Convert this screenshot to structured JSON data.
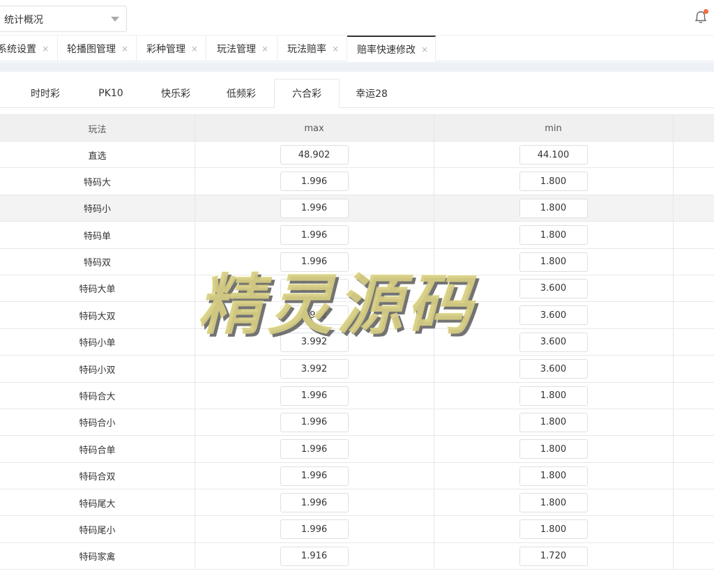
{
  "header": {
    "select_value": "统计概况"
  },
  "tabs": [
    {
      "label": "系统设置",
      "close": "×"
    },
    {
      "label": "轮播图管理",
      "close": "×"
    },
    {
      "label": "彩种管理",
      "close": "×"
    },
    {
      "label": "玩法管理",
      "close": "×"
    },
    {
      "label": "玩法赔率",
      "close": "×"
    },
    {
      "label": "赔率快速修改",
      "close": "×"
    }
  ],
  "subtabs": [
    "时时彩",
    "PK10",
    "快乐彩",
    "低频彩",
    "六合彩",
    "幸运28"
  ],
  "table": {
    "headers": [
      "玩法",
      "max",
      "min"
    ],
    "rows": [
      {
        "name": "直选",
        "max": "48.902",
        "min": "44.100"
      },
      {
        "name": "特码大",
        "max": "1.996",
        "min": "1.800"
      },
      {
        "name": "特码小",
        "max": "1.996",
        "min": "1.800"
      },
      {
        "name": "特码单",
        "max": "1.996",
        "min": "1.800"
      },
      {
        "name": "特码双",
        "max": "1.996",
        "min": "1.800"
      },
      {
        "name": "特码大单",
        "max": "3.992",
        "min": "3.600"
      },
      {
        "name": "特码大双",
        "max": "3.992",
        "min": "3.600"
      },
      {
        "name": "特码小单",
        "max": "3.992",
        "min": "3.600"
      },
      {
        "name": "特码小双",
        "max": "3.992",
        "min": "3.600"
      },
      {
        "name": "特码合大",
        "max": "1.996",
        "min": "1.800"
      },
      {
        "name": "特码合小",
        "max": "1.996",
        "min": "1.800"
      },
      {
        "name": "特码合单",
        "max": "1.996",
        "min": "1.800"
      },
      {
        "name": "特码合双",
        "max": "1.996",
        "min": "1.800"
      },
      {
        "name": "特码尾大",
        "max": "1.996",
        "min": "1.800"
      },
      {
        "name": "特码尾小",
        "max": "1.996",
        "min": "1.800"
      },
      {
        "name": "特码家禽",
        "max": "1.916",
        "min": "1.720"
      }
    ]
  },
  "watermark": "精灵源码",
  "colors": {
    "notification_dot": "#f56c3b",
    "active_tab_border": "#333333"
  }
}
